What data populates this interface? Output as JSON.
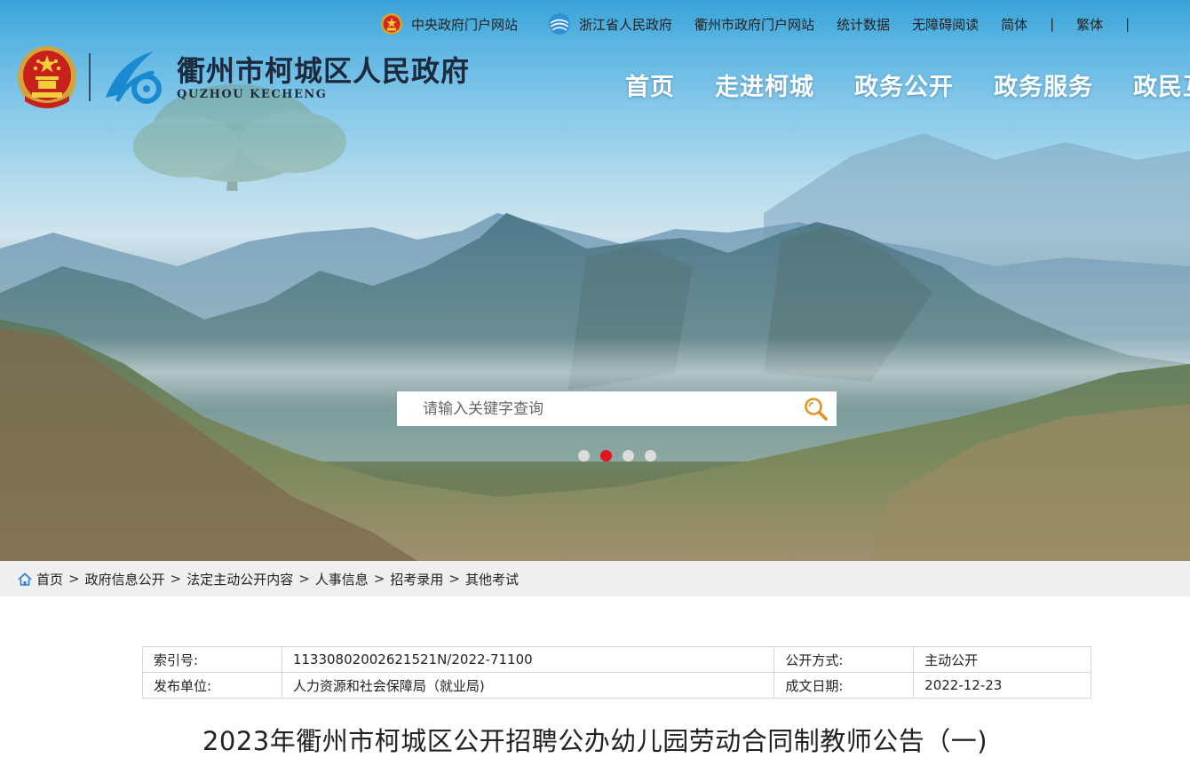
{
  "toplinks": {
    "central_gov": "中央政府门户网站",
    "zhejiang_gov": "浙江省人民政府",
    "quzhou_gov": "衢州市政府门户网站",
    "stats": "统计数据",
    "accessible": "无障碍阅读",
    "simplified": "简体",
    "separator": "|",
    "traditional": "繁体"
  },
  "logo": {
    "title": "衢州市柯城区人民政府",
    "subtitle": "QUZHOU  KECHENG"
  },
  "nav": {
    "items": [
      "首页",
      "走进柯城",
      "政务公开",
      "政务服务",
      "政民互动"
    ]
  },
  "search": {
    "placeholder": "请输入关键字查询"
  },
  "carousel": {
    "active_index": 1,
    "count": 4
  },
  "breadcrumb": {
    "items": [
      "首页",
      "政府信息公开",
      "法定主动公开内容",
      "人事信息",
      "招考录用",
      "其他考试"
    ],
    "separator": ">"
  },
  "meta": {
    "index_label": "索引号:",
    "index_value": "11330802002621521N/2022-71100",
    "mode_label": "公开方式:",
    "mode_value": "主动公开",
    "publisher_label": "发布单位:",
    "publisher_value": "人力资源和社会保障局（就业局)",
    "date_label": "成文日期:",
    "date_value": "2022-12-23"
  },
  "article": {
    "title": "2023年衢州市柯城区公开招聘公办幼儿园劳动合同制教师公告（一)"
  },
  "colors": {
    "accent_red": "#e0161c",
    "search_icon": "#e0931f",
    "logo_blue": "#1a8ad0"
  }
}
